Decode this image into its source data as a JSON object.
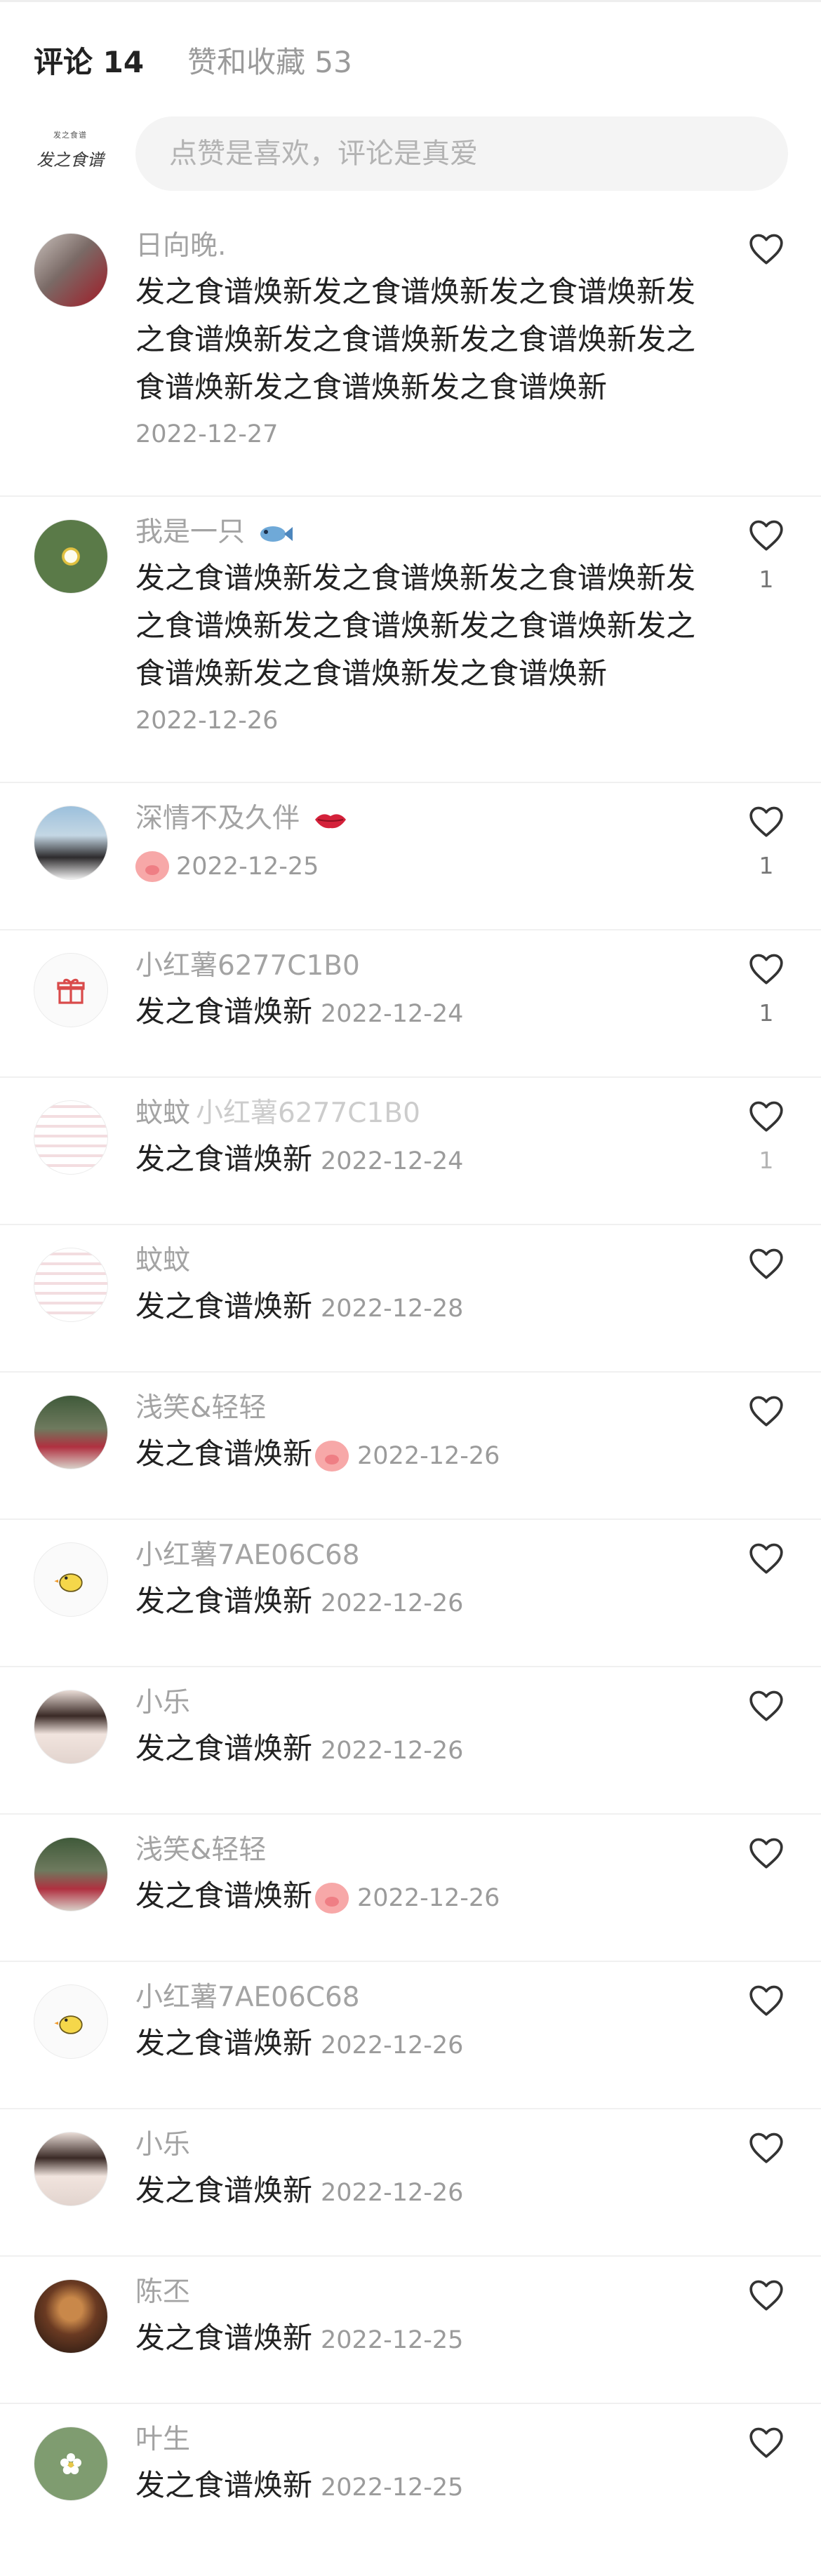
{
  "tabs": {
    "comments_label": "评论 14",
    "likes_label": "赞和收藏 53"
  },
  "my_avatar": {
    "logo_sub": "发之食谱",
    "logo_main": "发之食谱"
  },
  "input": {
    "placeholder": "点赞是喜欢，评论是真爱"
  },
  "colors": {
    "username": "#a3a3a3",
    "text": "#222222",
    "date": "#9b9b9b",
    "input_bg": "#f4f4f4"
  },
  "comments": [
    {
      "username": "日向晚.",
      "avatar_icon": "photo-avatar",
      "lines": [
        "发之食谱焕新发之食谱焕新发之食谱焕新发",
        "之食谱焕新发之食谱焕新发之食谱焕新发之",
        "食谱焕新发之食谱焕新发之食谱焕新"
      ],
      "date": "2022-12-27",
      "likes": ""
    },
    {
      "username": "我是一只",
      "username_emoji": "fish-emoji",
      "avatar_icon": "flower-photo-avatar",
      "lines": [
        "发之食谱焕新发之食谱焕新发之食谱焕新发",
        "之食谱焕新发之食谱焕新发之食谱焕新发之",
        "食谱焕新发之食谱焕新发之食谱焕新"
      ],
      "date": "2022-12-26",
      "likes": "1"
    },
    {
      "username": "深情不及久伴",
      "username_emoji": "lips-emoji",
      "avatar_icon": "photo-avatar",
      "text_emoji": "pig-emoji",
      "text": "",
      "date": "2022-12-25",
      "likes": "1"
    },
    {
      "username": "小红薯6277C1B0",
      "avatar_icon": "gift-icon",
      "text": "发之食谱焕新",
      "date": "2022-12-24",
      "likes": "1"
    },
    {
      "username": "蚊蚊",
      "username_faded": "小红薯6277C1B0",
      "avatar_icon": "photo-avatar",
      "text": "发之食谱焕新",
      "date": "2022-12-24",
      "likes": "1"
    },
    {
      "username": "蚊蚊",
      "avatar_icon": "photo-avatar",
      "text": "发之食谱焕新",
      "date": "2022-12-28",
      "likes": ""
    },
    {
      "username": "浅笑&轻轻",
      "avatar_icon": "photo-avatar",
      "text": "发之食谱焕新",
      "text_emoji": "pig-emoji",
      "date": "2022-12-26",
      "likes": ""
    },
    {
      "username": "小红薯7AE06C68",
      "avatar_icon": "chick-icon",
      "text": "发之食谱焕新",
      "date": "2022-12-26",
      "likes": ""
    },
    {
      "username": "小乐",
      "avatar_icon": "photo-avatar",
      "text": "发之食谱焕新",
      "date": "2022-12-26",
      "likes": ""
    },
    {
      "username": "浅笑&轻轻",
      "avatar_icon": "photo-avatar",
      "text": "发之食谱焕新",
      "text_emoji": "pig-emoji",
      "date": "2022-12-26",
      "likes": ""
    },
    {
      "username": "小红薯7AE06C68",
      "avatar_icon": "chick-icon",
      "text": "发之食谱焕新",
      "date": "2022-12-26",
      "likes": ""
    },
    {
      "username": "小乐",
      "avatar_icon": "photo-avatar",
      "text": "发之食谱焕新",
      "date": "2022-12-26",
      "likes": ""
    },
    {
      "username": "陈丕",
      "avatar_icon": "photo-avatar",
      "text": "发之食谱焕新",
      "date": "2022-12-25",
      "likes": ""
    },
    {
      "username": "叶生",
      "avatar_icon": "flower-icon",
      "text": "发之食谱焕新",
      "date": "2022-12-25",
      "likes": ""
    }
  ]
}
